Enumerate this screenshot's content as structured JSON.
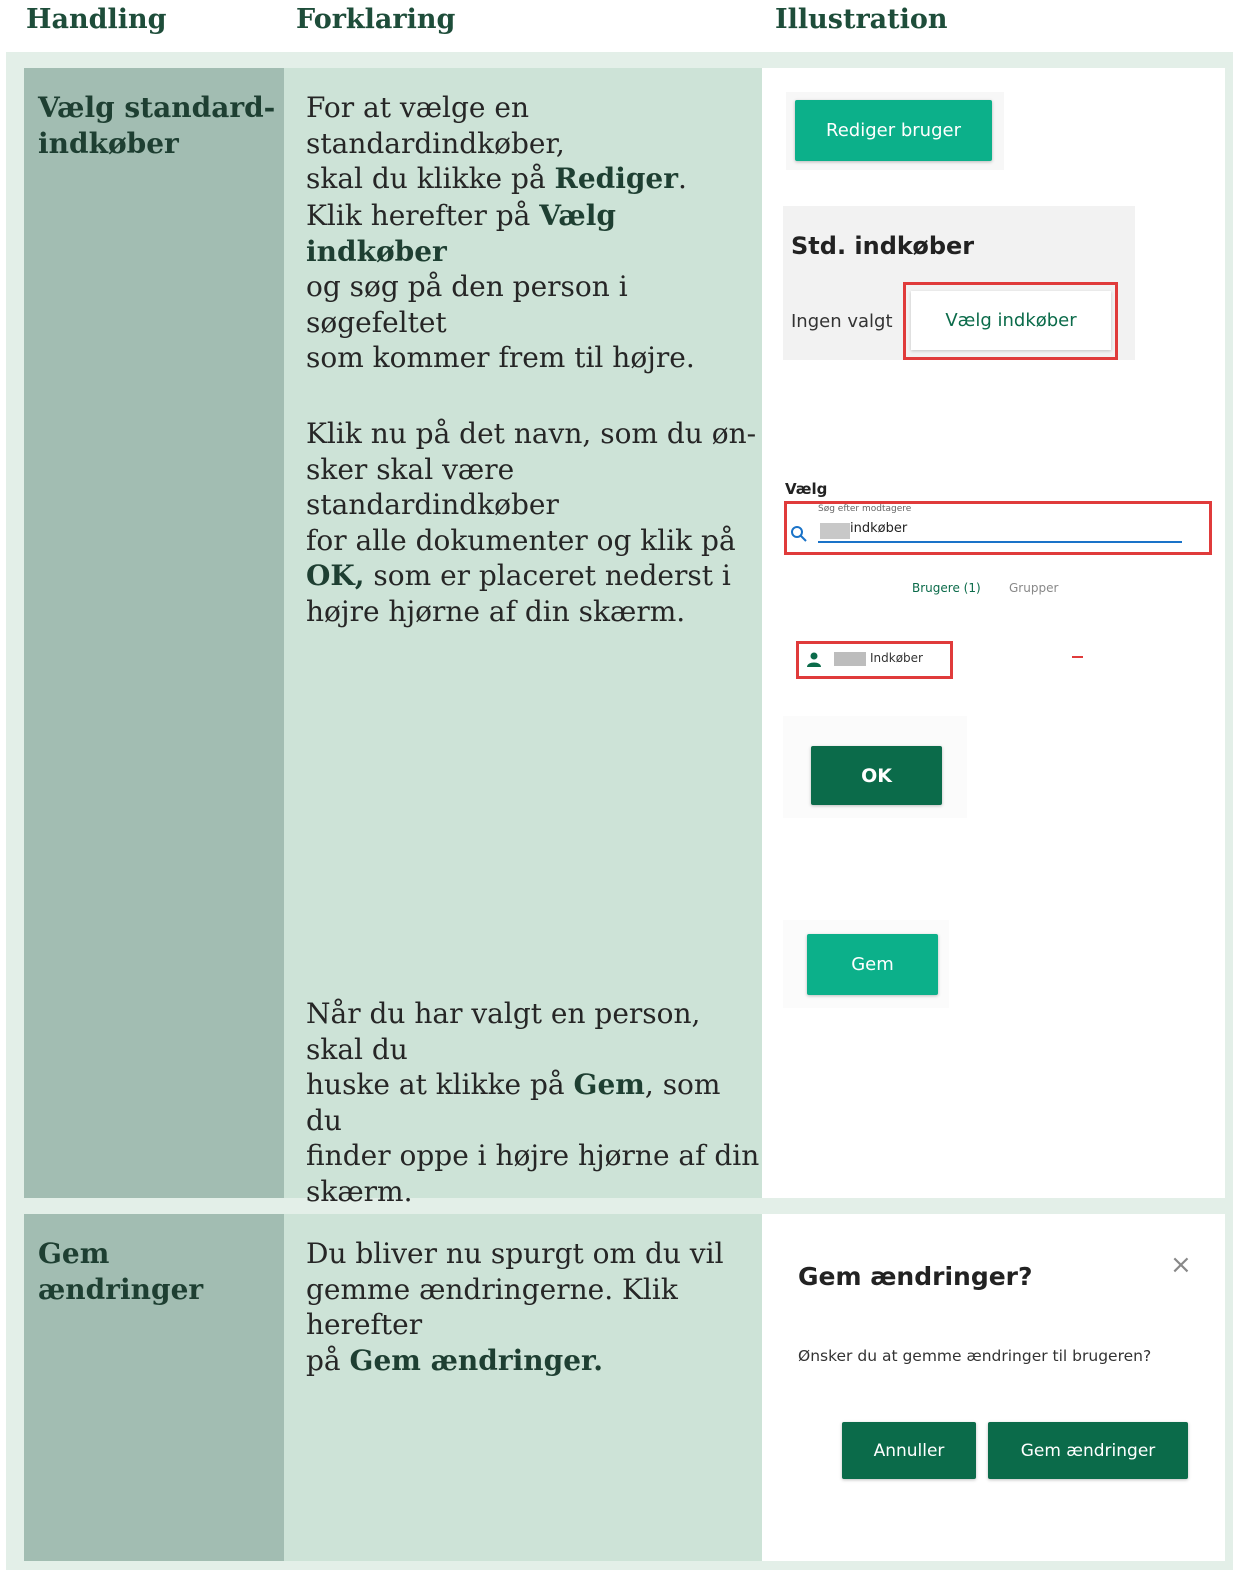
{
  "headers": {
    "col1": "Handling",
    "col2": "Forklaring",
    "col3": "Illustration"
  },
  "row1": {
    "action": "Vælg standard-\nindkøber",
    "step1": {
      "pre": "For at vælge en standardindkøber,\nskal du klikke på ",
      "bold": "Rediger",
      "post": "."
    },
    "step2": {
      "pre": "Klik herefter på ",
      "bold": "Vælg indkøber",
      "post": "\nog søg på den person i søgefeltet\nsom kommer frem til højre."
    },
    "step3": {
      "pre": "Klik nu på det navn, som du øn-\nsker skal være standardindkøber\nfor alle dokumenter og klik på\n",
      "bold": "OK,",
      "post": " som er placeret nederst i\nhøjre hjørne af din skærm."
    },
    "step4": {
      "pre": "Når du har valgt en person, skal du\nhuske at klikke på ",
      "bold": "Gem",
      "post": ", som du\nfinder oppe i højre hjørne af din\nskærm."
    },
    "ill_edit_button": "Rediger bruger",
    "ill_std": {
      "title": "Std. indkøber",
      "none": "Ingen valgt",
      "choose": "Vælg indkøber"
    },
    "ill_select": {
      "title": "Vælg",
      "search_label": "Søg efter modtagere",
      "search_value": "indkøber",
      "tab_users": "Brugere (1)",
      "tab_groups": "Grupper",
      "result": "Indkøber"
    },
    "ill_ok": "OK",
    "ill_save": "Gem"
  },
  "row2": {
    "action": "Gem ændringer",
    "step": {
      "pre": "Du bliver nu spurgt om du vil\ngemme ændringerne. Klik herefter\npå ",
      "bold": "Gem ændringer.",
      "post": ""
    },
    "dialog": {
      "title": "Gem ændringer?",
      "close": "×",
      "message": "Ønsker du at gemme ændringer til brugeren?",
      "cancel": "Annuller",
      "confirm": "Gem ændringer"
    }
  },
  "colors": {
    "teal": "#0cb08a",
    "dark_green": "#0b6b4a",
    "red_highlight": "#e03b3b",
    "col1_bg": "#a2bdb2",
    "col2_bg": "#cde3d7"
  }
}
